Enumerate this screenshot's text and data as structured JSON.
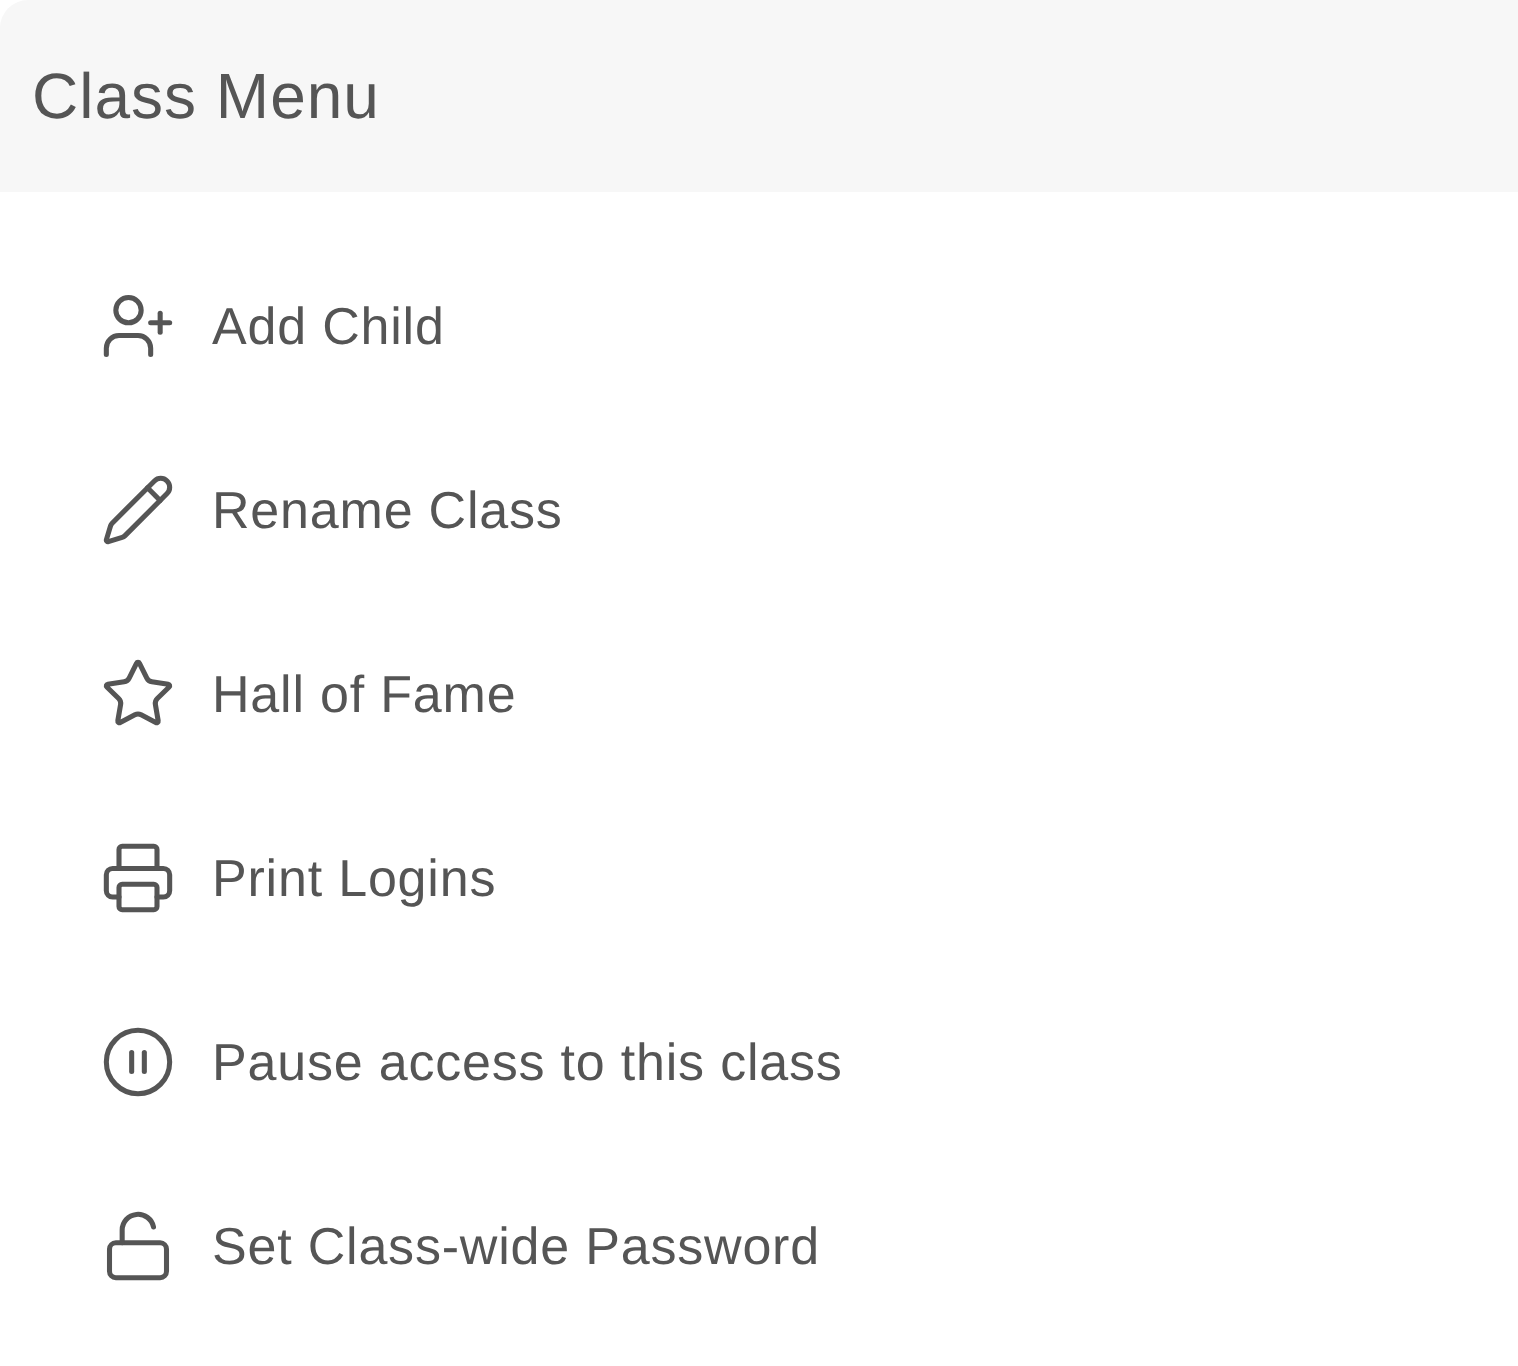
{
  "header": {
    "title": "Class Menu"
  },
  "items": [
    {
      "kind": "add",
      "label": "Add Child"
    },
    {
      "kind": "rename",
      "label": "Rename Class"
    },
    {
      "kind": "fame",
      "label": "Hall of Fame"
    },
    {
      "kind": "print",
      "label": "Print Logins"
    },
    {
      "kind": "pause",
      "label": "Pause access to this class"
    },
    {
      "kind": "unlock",
      "label": "Set Class-wide Password"
    }
  ]
}
